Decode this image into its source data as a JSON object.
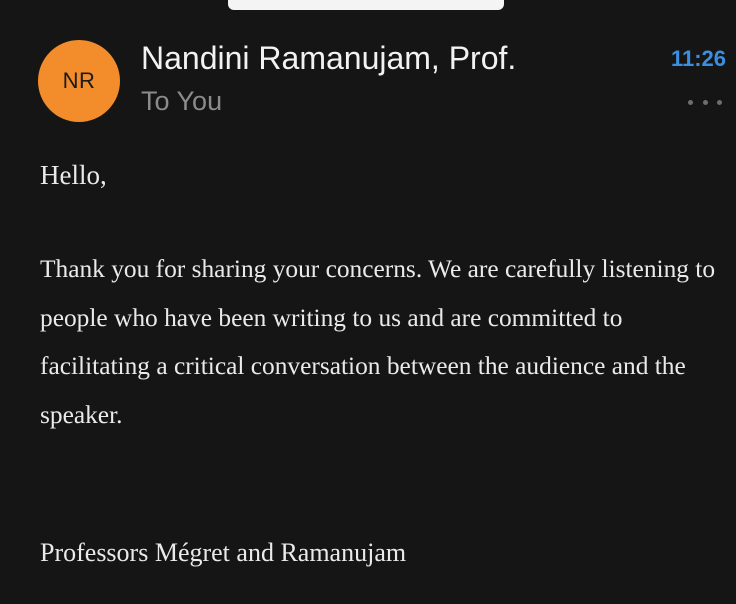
{
  "message": {
    "sender": {
      "initials": "NR",
      "name": "Nandini Ramanujam, Prof.",
      "avatar_color": "#f38c2a"
    },
    "recipient_line": "To You",
    "time": "11:26",
    "time_color": "#3a8fe0",
    "more_icon": "more-horizontal-icon",
    "body": {
      "greeting": "Hello,",
      "paragraph": "Thank you for sharing your concerns. We are carefully listening to people who have been writing to us and are committed to facilitating a critical conversation between the audience and the speaker.",
      "signature": "Professors Mégret and Ramanujam"
    }
  },
  "theme": {
    "background": "#151515",
    "text": "#eaeaea",
    "muted_text": "#8b8b8b"
  }
}
